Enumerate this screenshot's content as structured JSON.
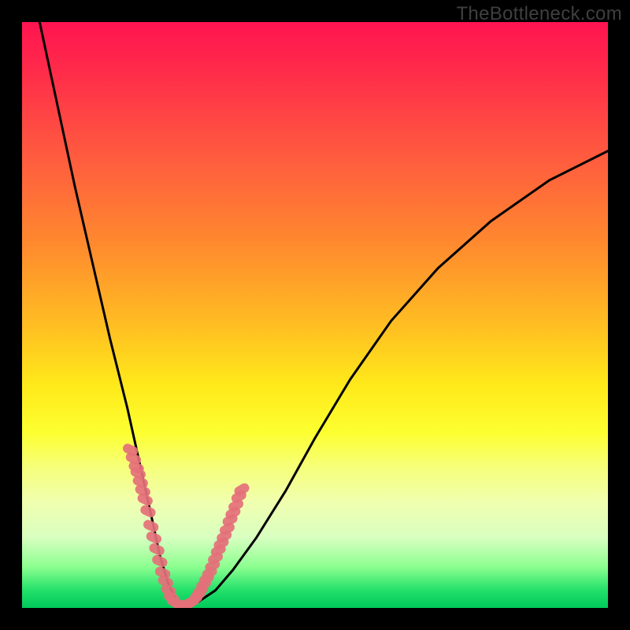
{
  "watermark": "TheBottleneck.com",
  "chart_data": {
    "type": "line",
    "title": "",
    "xlabel": "",
    "ylabel": "",
    "xlim": [
      0,
      100
    ],
    "ylim": [
      0,
      100
    ],
    "series": [
      {
        "name": "main-curve",
        "x": [
          3,
          6,
          9,
          12,
          15,
          18,
          20,
          22,
          23.5,
          25,
          26.5,
          28,
          30,
          33,
          36,
          40,
          45,
          50,
          56,
          63,
          71,
          80,
          90,
          100
        ],
        "y": [
          100,
          86,
          72,
          59,
          46,
          34,
          25,
          16,
          9,
          4,
          1,
          0.5,
          1,
          3,
          6.5,
          12,
          20,
          29,
          39,
          49,
          58,
          66,
          73,
          78
        ]
      }
    ],
    "markers_left": {
      "x": [
        18.5,
        19,
        19.5,
        19.8,
        20.2,
        20.6,
        21,
        21.5,
        22,
        22.5,
        23,
        23.5,
        24,
        24.5,
        25,
        25.5,
        26
      ],
      "y": [
        27,
        25.5,
        24,
        23,
        21.5,
        20,
        18.5,
        16.5,
        14,
        12,
        10,
        8,
        6,
        4.5,
        3,
        1.8,
        1
      ]
    },
    "markers_right": {
      "x": [
        29,
        29.5,
        30,
        30.5,
        31,
        31.5,
        32,
        32.5,
        33,
        33.5,
        34,
        34.5,
        35,
        35.5,
        36,
        36.5,
        37,
        37.5
      ],
      "y": [
        1,
        1.5,
        2.2,
        3,
        4,
        5,
        6,
        7.2,
        8.5,
        9.8,
        11,
        12.2,
        13.5,
        15,
        16.2,
        17.5,
        19,
        20.2
      ]
    },
    "markers_bottom": {
      "x": [
        26.5,
        27,
        27.5,
        28,
        28.5
      ],
      "y": [
        0.7,
        0.5,
        0.5,
        0.6,
        0.8
      ]
    },
    "marker_color": "#e4707a",
    "curve_color": "#000000"
  }
}
